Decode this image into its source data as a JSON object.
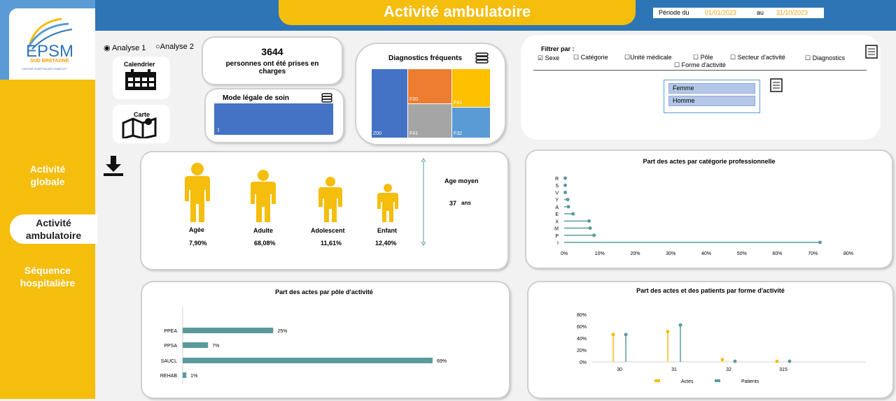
{
  "header": {
    "title": "Activité ambulatoire",
    "period_label": "Période du",
    "period_from": "01/01/2023",
    "period_sep": "au",
    "period_to": "31/10/2023"
  },
  "logo": {
    "main": "EPSM",
    "sub": "SUD BRETAGNE",
    "tagline": "CENTRE HOSPITALIER CHARCOT"
  },
  "sidebar": {
    "items": [
      {
        "label": "Activité globale",
        "active": false
      },
      {
        "label": "Activité ambulatoire",
        "active": true
      },
      {
        "label": "Séquence hospitalière",
        "active": false
      }
    ]
  },
  "analysis": {
    "option1": "Analyse 1",
    "option2": "Analyse 2",
    "selected": "Analyse 1"
  },
  "buttons": {
    "calendar": "Calendrier",
    "map": "Carte"
  },
  "kpi": {
    "count": "3644",
    "label": "personnes ont été prises en charges"
  },
  "legal_mode": {
    "title": "Mode légale de soin",
    "bar_label": "1"
  },
  "diagnostics": {
    "title": "Diagnostics fréquents",
    "tiles": [
      "Z00",
      "F20",
      "F43",
      "F41",
      "F32"
    ]
  },
  "filters": {
    "title": "Filtrer par :",
    "options": [
      {
        "label": "Sexe",
        "checked": true
      },
      {
        "label": "Catégorie",
        "checked": false
      },
      {
        "label": "Unité médicale",
        "checked": false
      },
      {
        "label": "Pôle",
        "checked": false
      },
      {
        "label": "Secteur d'activité",
        "checked": false
      },
      {
        "label": "Diagnostics",
        "checked": false
      },
      {
        "label": "Forme d'activité",
        "checked": false
      }
    ],
    "values": [
      "Femme",
      "Homme"
    ]
  },
  "age": {
    "groups": [
      {
        "label": "Agée",
        "value": "7,90%"
      },
      {
        "label": "Adulte",
        "value": "68,08%"
      },
      {
        "label": "Adolescent",
        "value": "11,61%"
      },
      {
        "label": "Enfant",
        "value": "12,40%"
      }
    ],
    "mean_label": "Age moyen",
    "mean_value": "37",
    "mean_unit": "ans"
  },
  "colors": {
    "accent": "#f5bd0c",
    "header": "#2e75b6",
    "teal": "#5a9a9d",
    "blue": "#4472c4"
  },
  "chart_data": [
    {
      "type": "scatter",
      "title": "Part des actes par catégorie professionnelle",
      "categories": [
        "R",
        "S",
        "V",
        "Y",
        "A",
        "E",
        "X",
        "M",
        "P",
        "I"
      ],
      "values": [
        0.3,
        0.3,
        0.3,
        1,
        1.2,
        2.5,
        7,
        7.3,
        8.4,
        72
      ],
      "xlim": [
        0,
        80
      ],
      "xticks": [
        "0%",
        "10%",
        "20%",
        "30%",
        "40%",
        "50%",
        "60%",
        "70%",
        "80%"
      ]
    },
    {
      "type": "bar",
      "title": "Part des actes par pôle d'activité",
      "categories": [
        "PPEA",
        "PPSA",
        "SAUCL",
        "REHAB"
      ],
      "values": [
        25,
        7,
        69,
        1
      ],
      "labels": [
        "25%",
        "7%",
        "69%",
        "1%"
      ]
    },
    {
      "type": "scatter",
      "title": "Part des actes et des patients par forme d'activité",
      "categories": [
        "30",
        "31",
        "32",
        "315"
      ],
      "series": [
        {
          "name": "Actes",
          "values": [
            46,
            51,
            4,
            1
          ]
        },
        {
          "name": "Patients",
          "values": [
            46,
            62,
            1,
            1
          ]
        }
      ],
      "ylim": [
        0,
        80
      ],
      "yticks": [
        "0%",
        "20%",
        "40%",
        "60%",
        "80%"
      ]
    }
  ]
}
